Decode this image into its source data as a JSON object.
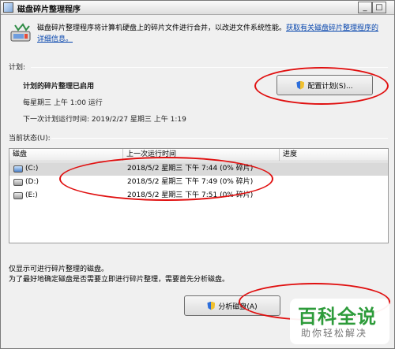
{
  "window": {
    "title": "磁盘碎片整理程序"
  },
  "intro": {
    "text": "磁盘碎片整理程序将计算机硬盘上的碎片文件进行合并，以改进文件系统性能。",
    "link": "获取有关磁盘碎片整理程序的详细信息。"
  },
  "schedule": {
    "section_label": "计划:",
    "status": "计划的碎片整理已启用",
    "recurrence": "每星期三 上午 1:00 运行",
    "next_run": "下一次计划运行时间: 2019/2/27 星期三 上午 1:19",
    "configure_button": "配置计划(S)..."
  },
  "current_status": {
    "section_label": "当前状态(U):",
    "columns": [
      "磁盘",
      "上一次运行时间",
      "进度"
    ],
    "rows": [
      {
        "disk": "(C:)",
        "last_run": "2018/5/2 星期三 下午 7:44 (0% 碎片)",
        "progress": ""
      },
      {
        "disk": "(D:)",
        "last_run": "2018/5/2 星期三 下午 7:49 (0% 碎片)",
        "progress": ""
      },
      {
        "disk": "(E:)",
        "last_run": "2018/5/2 星期三 下午 7:51 (0% 碎片)",
        "progress": ""
      }
    ]
  },
  "notes": {
    "line1": "仅显示可进行碎片整理的磁盘。",
    "line2": "为了最好地确定磁盘是否需要立即进行碎片整理，需要首先分析磁盘。"
  },
  "actions": {
    "analyze_button": "分析磁盘(A)"
  },
  "watermark": {
    "main": "百科全说",
    "sub": "助你轻松解决"
  },
  "colors": {
    "annotation": "#e01010",
    "watermark_green": "#2d9b3a"
  }
}
